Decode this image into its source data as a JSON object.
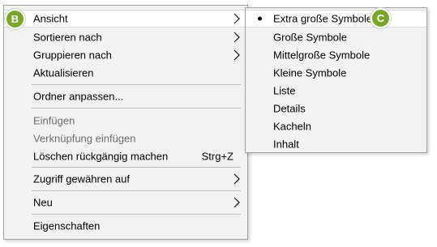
{
  "menu": {
    "items": [
      {
        "label": "Ansicht",
        "has_submenu": true,
        "enabled": true,
        "highlighted": true
      },
      {
        "label": "Sortieren nach",
        "has_submenu": true,
        "enabled": true
      },
      {
        "label": "Gruppieren nach",
        "has_submenu": true,
        "enabled": true
      },
      {
        "label": "Aktualisieren",
        "has_submenu": false,
        "enabled": true
      },
      {
        "label": "Ordner anpassen...",
        "has_submenu": false,
        "enabled": true
      },
      {
        "label": "Einfügen",
        "has_submenu": false,
        "enabled": false
      },
      {
        "label": "Verknüpfung einfügen",
        "has_submenu": false,
        "enabled": false
      },
      {
        "label": "Löschen rückgängig machen",
        "shortcut": "Strg+Z",
        "has_submenu": false,
        "enabled": true
      },
      {
        "label": "Zugriff gewähren auf",
        "has_submenu": true,
        "enabled": true
      },
      {
        "label": "Neu",
        "has_submenu": true,
        "enabled": true
      },
      {
        "label": "Eigenschaften",
        "has_submenu": false,
        "enabled": true
      }
    ]
  },
  "submenu": {
    "items": [
      {
        "label": "Extra große Symbole",
        "selected": true
      },
      {
        "label": "Große Symbole"
      },
      {
        "label": "Mittelgroße Symbole"
      },
      {
        "label": "Kleine Symbole"
      },
      {
        "label": "Liste"
      },
      {
        "label": "Details"
      },
      {
        "label": "Kacheln"
      },
      {
        "label": "Inhalt"
      }
    ]
  },
  "callouts": {
    "b": "B",
    "c": "C"
  },
  "colors": {
    "callout": "#7aa62c",
    "menu_bg": "#f2f2f2",
    "highlight_bg": "#ffffff",
    "disabled_text": "#6d6d6d"
  },
  "icons": {
    "submenu_arrow": "chevron-right-icon",
    "selected_marker": "radio-dot-icon"
  }
}
